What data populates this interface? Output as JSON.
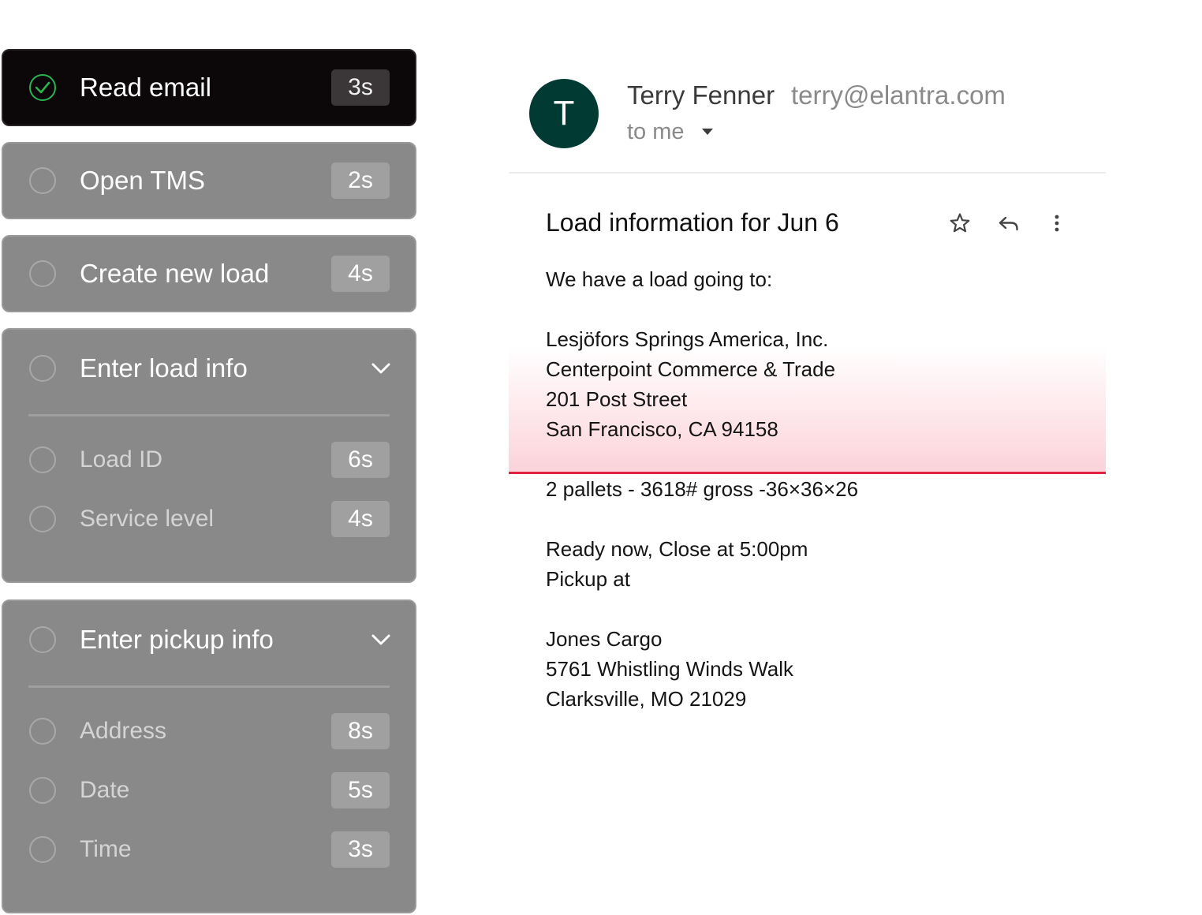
{
  "steps": [
    {
      "label": "Read email",
      "time": "3s",
      "done": true
    },
    {
      "label": "Open TMS",
      "time": "2s"
    },
    {
      "label": "Create new load",
      "time": "4s"
    },
    {
      "label": "Enter load info",
      "substeps": [
        {
          "label": "Load ID",
          "time": "6s"
        },
        {
          "label": "Service level",
          "time": "4s"
        }
      ]
    },
    {
      "label": "Enter pickup info",
      "substeps": [
        {
          "label": "Address",
          "time": "8s"
        },
        {
          "label": "Date",
          "time": "5s"
        },
        {
          "label": "Time",
          "time": "3s"
        }
      ]
    }
  ],
  "email": {
    "avatar_letter": "T",
    "sender_name": "Terry Fenner",
    "sender_email": "terry@elantra.com",
    "to": "to me",
    "subject": "Load information for Jun 6",
    "body": [
      "We have a load going to:",
      "Lesjöfors Springs America, Inc.",
      "Centerpoint Commerce & Trade",
      "201 Post Street",
      "San Francisco, CA 94158",
      "2 pallets - 3618# gross -36×36×26",
      "Ready now, Close at 5:00pm",
      "Pickup at",
      "Jones Cargo",
      "5761 Whistling Winds Walk",
      "Clarksville, MO 21029"
    ]
  },
  "icons": {
    "check": "check-circle-icon",
    "star": "star-icon",
    "reply": "reply-icon",
    "more": "more-vert-icon",
    "chevron": "chevron-down-icon",
    "caret": "caret-down-icon"
  },
  "colors": {
    "done_check": "#2ab34f",
    "avatar_bg": "#003a33",
    "highlight_line": "#e0243f",
    "highlight_fill": "#fcd3da"
  }
}
